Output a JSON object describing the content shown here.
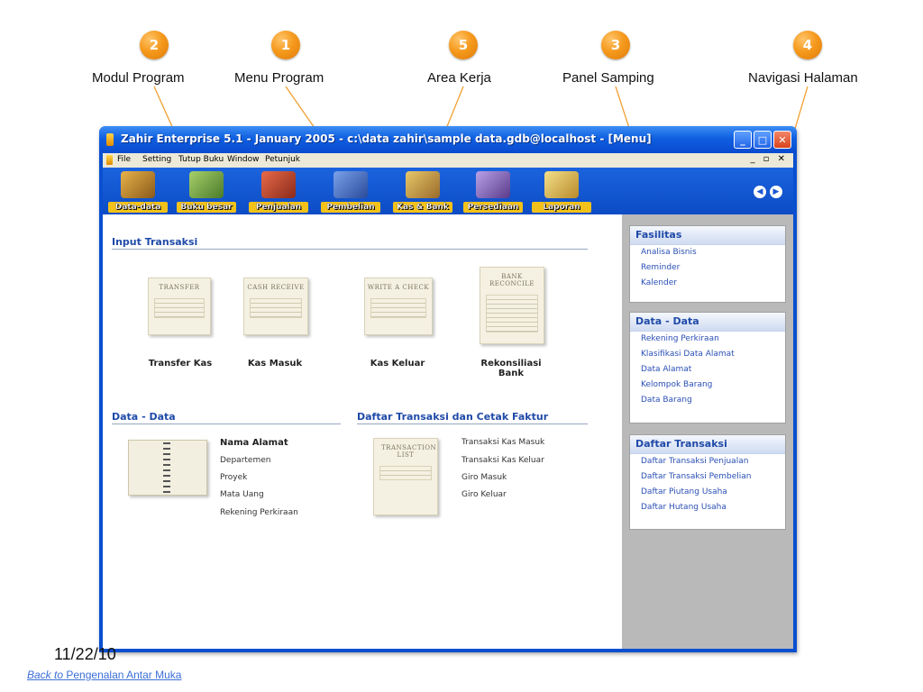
{
  "callouts": [
    {
      "number": "2",
      "label": "Modul Program"
    },
    {
      "number": "1",
      "label": "Menu Program"
    },
    {
      "number": "5",
      "label": "Area Kerja"
    },
    {
      "number": "3",
      "label": "Panel Samping"
    },
    {
      "number": "4",
      "label": "Navigasi Halaman"
    }
  ],
  "window": {
    "title": "Zahir Enterprise 5.1 - January 2005 - c:\\data zahir\\sample data.gdb@localhost - [Menu]",
    "controls": {
      "minimize": "_",
      "maximize": "□",
      "close": "✕"
    }
  },
  "menu": {
    "items": [
      "File",
      "Setting",
      "Tutup Buku",
      "Window",
      "Petunjuk"
    ],
    "right_controls": "_ ▫ ✕"
  },
  "toolbar": {
    "modules": [
      {
        "label": "Data-data",
        "icon": "tools-icon",
        "color": "#c88a2a"
      },
      {
        "label": "Buku besar",
        "icon": "ledger-book-icon",
        "color": "#6a9a3a"
      },
      {
        "label": "Penjualan",
        "icon": "shopping-basket-icon",
        "color": "#b83a2a"
      },
      {
        "label": "Pembelian",
        "icon": "cart-icon",
        "color": "#3a6ac8"
      },
      {
        "label": "Kas & Bank",
        "icon": "cash-bank-icon",
        "color": "#c8a23a"
      },
      {
        "label": "Persediaan",
        "icon": "inventory-icon",
        "color": "#8a6ab8"
      },
      {
        "label": "Laporan",
        "icon": "report-icon",
        "color": "#d8b83a"
      }
    ],
    "nav": {
      "prev": "◀",
      "next": "▶"
    }
  },
  "main": {
    "input_transaksi": {
      "title": "Input Transaksi",
      "items": [
        {
          "card_text": "TRANSFER",
          "label": "Transfer Kas"
        },
        {
          "card_text": "CASH RECEIVE",
          "label": "Kas Masuk"
        },
        {
          "card_text": "WRITE A CHECK",
          "label": "Kas Keluar"
        },
        {
          "card_text": "BANK RECONCILE",
          "label": "Rekonsiliasi Bank"
        }
      ]
    },
    "data_data": {
      "title": "Data - Data",
      "items": [
        "Nama Alamat",
        "Departemen",
        "Proyek",
        "Mata Uang",
        "Rekening Perkiraan"
      ]
    },
    "daftar_transaksi": {
      "title": "Daftar Transaksi dan Cetak Faktur",
      "card_text": "TRANSACTION LIST",
      "items": [
        "Transaksi Kas Masuk",
        "Transaksi Kas Keluar",
        "Giro Masuk",
        "Giro Keluar"
      ]
    }
  },
  "sidebar": {
    "panels": [
      {
        "title": "Fasilitas",
        "links": [
          "Analisa Bisnis",
          "Reminder",
          "Kalender"
        ]
      },
      {
        "title": "Data - Data",
        "links": [
          "Rekening Perkiraan",
          "Klasifikasi Data Alamat",
          "Data Alamat",
          "Kelompok Barang",
          "Data Barang"
        ]
      },
      {
        "title": "Daftar Transaksi",
        "links": [
          "Daftar Transaksi Penjualan",
          "Daftar Transaksi Pembelian",
          "Daftar Piutang Usaha",
          "Daftar Hutang Usaha"
        ]
      }
    ]
  },
  "footer": {
    "date": "11/22/10",
    "back_prefix": "Back to",
    "back_link": "Pengenalan Antar Muka"
  }
}
